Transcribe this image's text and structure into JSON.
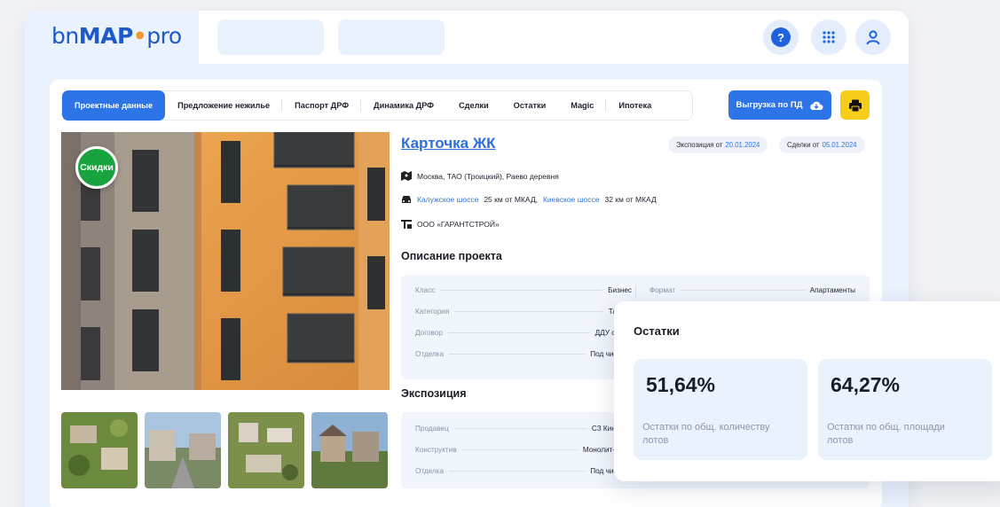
{
  "header": {
    "logo_prefix": "bn",
    "logo_bold": "MAP",
    "logo_pin": "●",
    "logo_suffix": "pro",
    "help_label": "?"
  },
  "tabs": [
    {
      "label": "Проектные данные",
      "active": true
    },
    {
      "label": "Предложение нежилье",
      "active": false
    },
    {
      "label": "Паспорт ДРФ",
      "active": false
    },
    {
      "label": "Динамика ДРФ",
      "active": false
    },
    {
      "label": "Сделки",
      "active": false
    },
    {
      "label": "Остатки",
      "active": false
    },
    {
      "label": "Magic",
      "active": false
    },
    {
      "label": "Ипотека",
      "active": false
    }
  ],
  "toolbar": {
    "export_label": "Выгрузка по ПД"
  },
  "photo": {
    "badge": "Скидки"
  },
  "card": {
    "title": "Карточка ЖК",
    "exposition_prefix": "Экспозиция от",
    "exposition_date": "20.01.2024",
    "deals_prefix": "Сделки от",
    "deals_date": "05.01.2024",
    "address": "Москва, ТАО (Троицкий), Раево деревня",
    "road1": "Калужское шоссе",
    "road1_dist": "25 км от МКАД,",
    "road2": "Киевское шоссе",
    "road2_dist": "32 км от МКАД",
    "developer": "ООО «ГАРАНТСТРОЙ»"
  },
  "description": {
    "title": "Описание проекта",
    "rows": [
      {
        "key": "Класс",
        "value": "Бизнес"
      },
      {
        "key": "Категория",
        "value": "Таунха"
      },
      {
        "key": "Договор",
        "value": "ДДУ с эскр"
      },
      {
        "key": "Отделка",
        "value": "Под чистову"
      }
    ],
    "right_rows": [
      {
        "key": "Формат",
        "value": "Апартаменты"
      }
    ]
  },
  "exposition": {
    "title": "Экспозиция",
    "rows": [
      {
        "key": "Продавец",
        "value": "СЗ Киноцен"
      },
      {
        "key": "Конструктив",
        "value": "Монолит–кирп"
      },
      {
        "key": "Отделка",
        "value": "Под чистову"
      }
    ]
  },
  "remainders": {
    "title": "Остатки",
    "stats": [
      {
        "value": "51,64%",
        "caption": "Остатки по общ. количеству лотов"
      },
      {
        "value": "64,27%",
        "caption": "Остатки по общ. площади лотов"
      }
    ]
  },
  "colors": {
    "accent": "#2d75e6",
    "badge": "#19a33e",
    "print": "#f6cd1a",
    "logo_pin": "#f29a2e"
  }
}
